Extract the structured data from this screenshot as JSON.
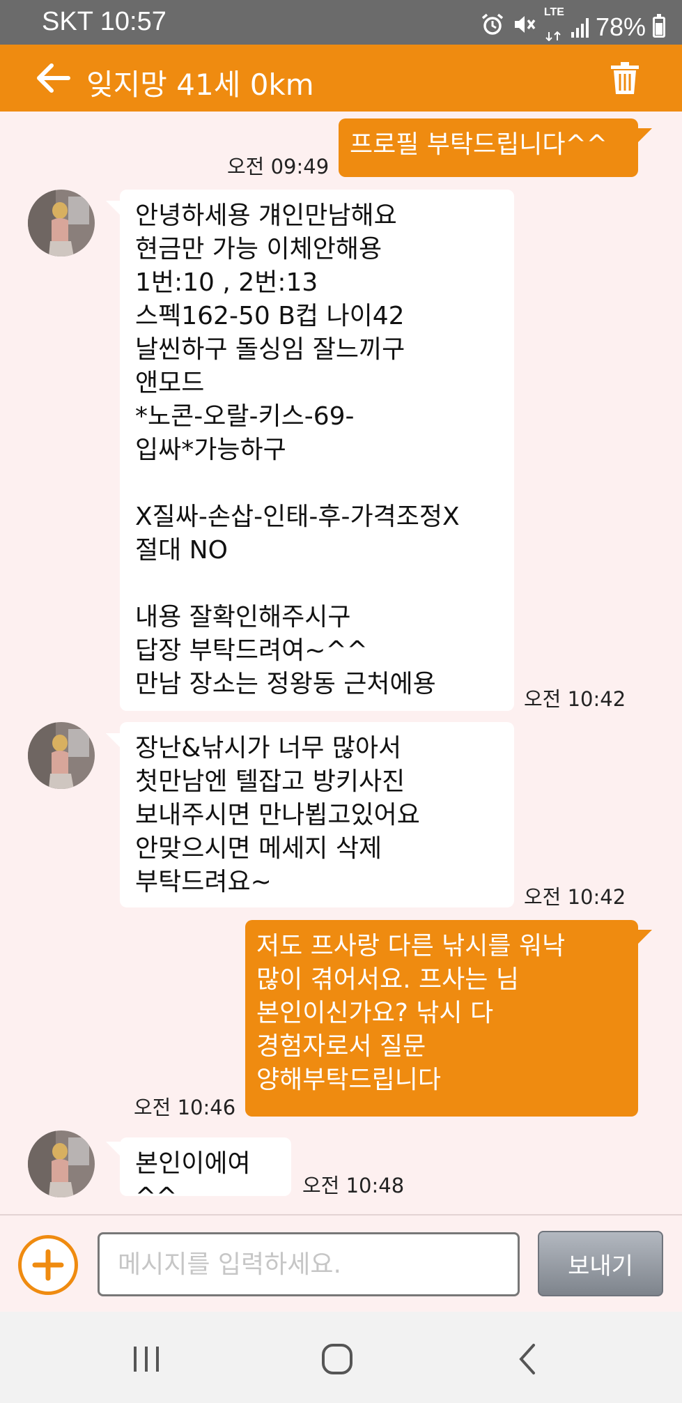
{
  "status_bar": {
    "carrier": "SKT",
    "time": "10:57",
    "network": "LTE",
    "battery": "78%",
    "icons": [
      "alarm-icon",
      "mute-icon",
      "lte-icon",
      "signal-icon",
      "battery-icon"
    ]
  },
  "header": {
    "title": "잊지망 41세 0km",
    "back_icon": "arrow-left-icon",
    "delete_icon": "trash-icon",
    "background": "#ef8b10"
  },
  "messages": [
    {
      "dir": "out",
      "text": "프로필 부탁드립니다^^",
      "time": "오전 09:49"
    },
    {
      "dir": "in",
      "text": "안녕하세용 걔인만남해요\n현금만 가능 이체안해용\n1번:10 , 2번:13\n스펙162-50 B컵 나이42\n날씬하구 돌싱임 잘느끼구\n앤모드\n*노콘-오랄-키스-69-\n입싸*가능하구\n\nX질싸-손삽-인태-후-가격조정X\n절대 NO\n\n내용 잘확인해주시구\n답장 부탁드려여~^^\n만남 장소는 정왕동 근처에용",
      "time": "오전 10:42"
    },
    {
      "dir": "in",
      "text": "장난&낚시가 너무 많아서\n첫만남엔 텔잡고 방키사진\n보내주시면 만나뵙고있어요\n안맞으시면  메세지 삭제\n부탁드려요~",
      "time": "오전 10:42"
    },
    {
      "dir": "out",
      "text": "저도 프사랑 다른 낚시를 워낙\n많이 겪어서요. 프사는 님\n본인이신가요? 낚시 다\n경험자로서 질문\n양해부탁드립니다",
      "time": "오전 10:46"
    },
    {
      "dir": "in",
      "text": "본인이에여^^",
      "time": "오전 10:48"
    }
  ],
  "composer": {
    "placeholder": "메시지를 입력하세요.",
    "value": "",
    "send_label": "보내기",
    "attach_icon": "plus-circle-icon"
  },
  "nav_bar": {
    "items": [
      "recent-apps-icon",
      "home-icon",
      "back-icon"
    ]
  },
  "colors": {
    "accent": "#ef8b10",
    "chat_background": "#fdf0f0",
    "incoming_bubble": "#ffffff",
    "status_bar": "#6b6b6b"
  }
}
